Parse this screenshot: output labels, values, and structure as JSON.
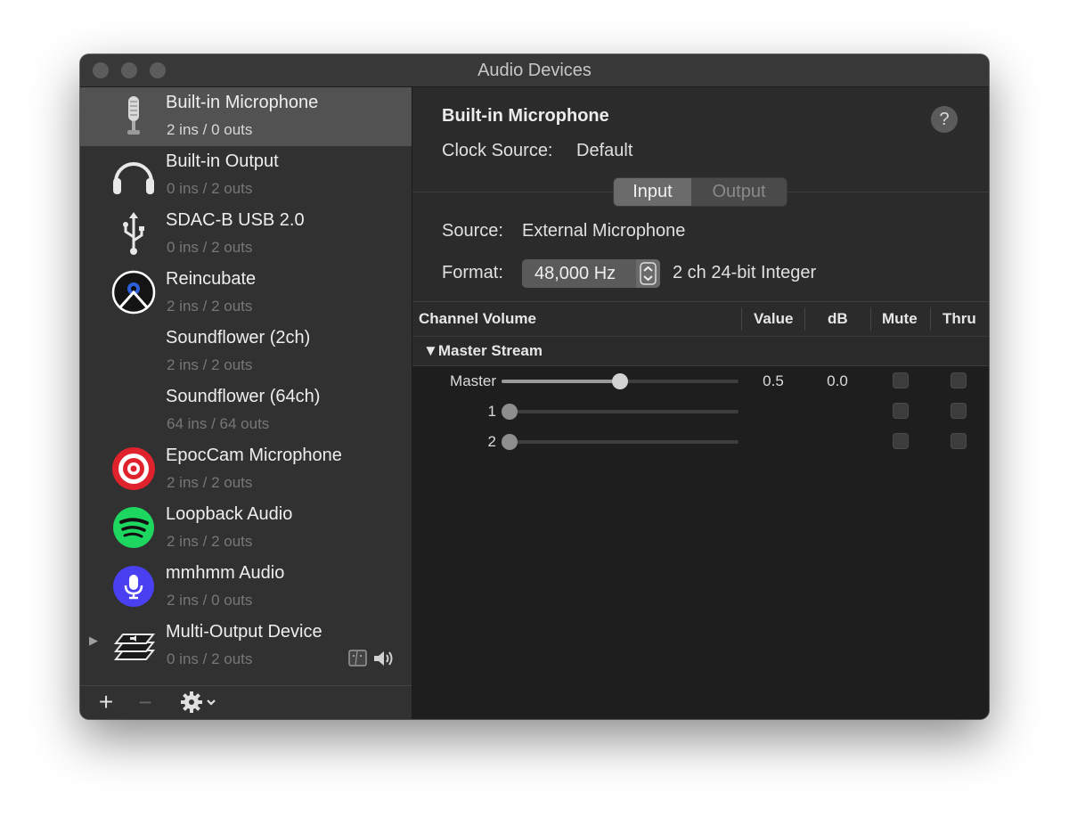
{
  "window": {
    "title": "Audio Devices"
  },
  "sidebar": {
    "devices": [
      {
        "name": "Built-in Microphone",
        "io": "2 ins / 0 outs",
        "icon": "microphone-icon",
        "selected": true
      },
      {
        "name": "Built-in Output",
        "io": "0 ins / 2 outs",
        "icon": "headphones-icon"
      },
      {
        "name": "SDAC-B USB 2.0",
        "io": "0 ins / 2 outs",
        "icon": "usb-icon"
      },
      {
        "name": "Reincubate",
        "io": "2 ins / 2 outs",
        "icon": "reincubate-icon"
      },
      {
        "name": "Soundflower (2ch)",
        "io": "2 ins / 2 outs",
        "icon": ""
      },
      {
        "name": "Soundflower (64ch)",
        "io": "64 ins / 64 outs",
        "icon": ""
      },
      {
        "name": "EpocCam Microphone",
        "io": "2 ins / 2 outs",
        "icon": "epoccam-icon"
      },
      {
        "name": "Loopback Audio",
        "io": "2 ins / 2 outs",
        "icon": "spotify-icon"
      },
      {
        "name": "mmhmm Audio",
        "io": "2 ins / 0 outs",
        "icon": "mmhmm-mic-icon"
      },
      {
        "name": "Multi-Output Device",
        "io": "0 ins / 2 outs",
        "icon": "multi-output-icon"
      }
    ],
    "toolbar": {
      "add": "+",
      "remove": "−"
    }
  },
  "detail": {
    "device_name": "Built-in Microphone",
    "help": "?",
    "clock_source_label": "Clock Source:",
    "clock_source_value": "Default",
    "tabs": {
      "input": "Input",
      "output": "Output",
      "selected": "Input"
    },
    "source_label": "Source:",
    "source_value": "External Microphone",
    "format_label": "Format:",
    "format_rate": "48,000 Hz",
    "format_desc": "2 ch 24-bit Integer"
  },
  "volume_table": {
    "headers": {
      "channel": "Channel Volume",
      "value": "Value",
      "db": "dB",
      "mute": "Mute",
      "thru": "Thru"
    },
    "group": "▼Master Stream",
    "rows": [
      {
        "label": "Master",
        "level": 0.5,
        "value": "0.5",
        "db": "0.0"
      },
      {
        "label": "1",
        "level": 0,
        "value": "",
        "db": ""
      },
      {
        "label": "2",
        "level": 0,
        "value": "",
        "db": ""
      }
    ]
  },
  "colors": {
    "accent_red": "#e0222d",
    "spotify_green": "#1ed760",
    "mmhmm_blue": "#4b3ff2"
  }
}
